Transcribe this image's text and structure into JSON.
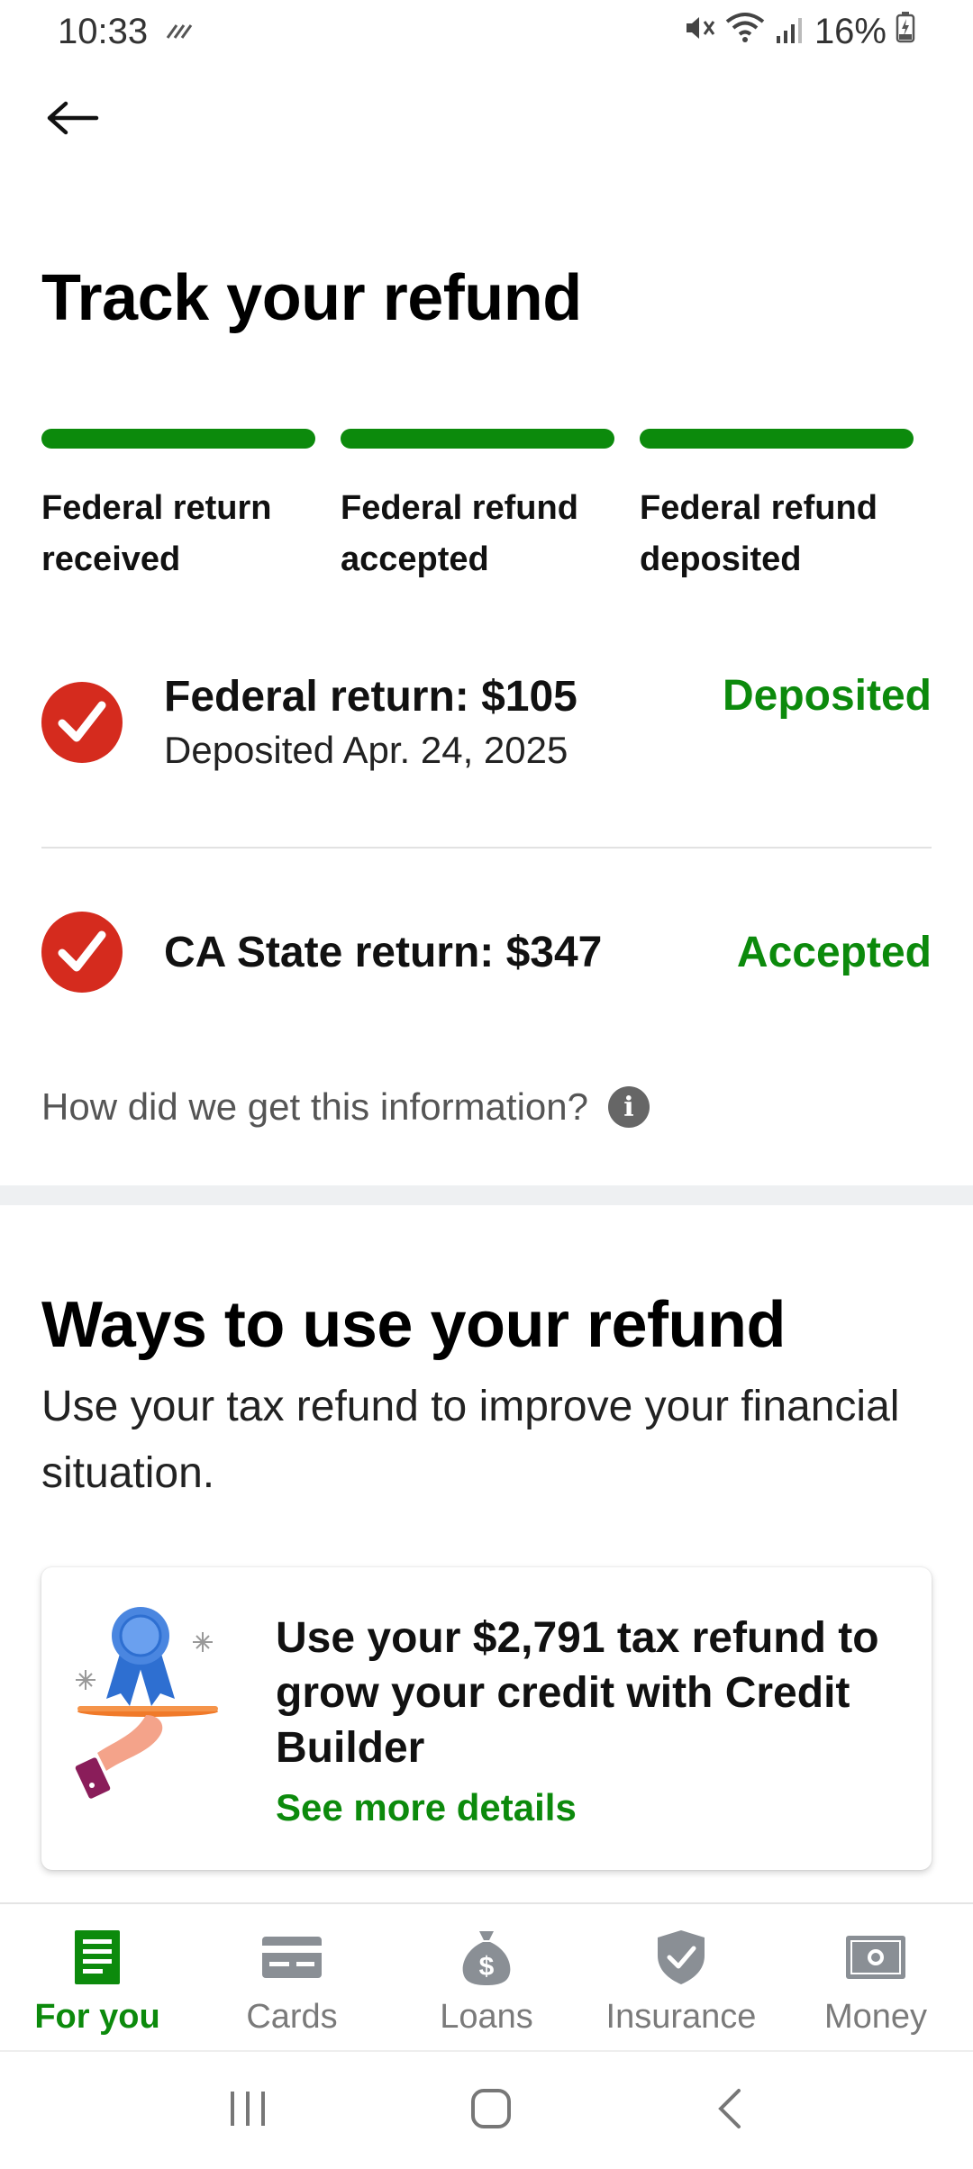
{
  "status_bar": {
    "time": "10:33",
    "battery": "16%"
  },
  "header": {
    "back_icon": "arrow-left-icon",
    "title": "Track your refund"
  },
  "progress": {
    "steps": [
      {
        "label": "Federal return received",
        "line1": "Federal return",
        "line2": "received",
        "complete": true
      },
      {
        "label": "Federal refund accepted",
        "line1": "Federal refund",
        "line2": "accepted",
        "complete": true
      },
      {
        "label": "Federal refund deposited",
        "line1": "Federal refund",
        "line2": "deposited",
        "complete": true
      }
    ],
    "bar_color": "#0c8a0c"
  },
  "refunds": [
    {
      "title": "Federal return: $105",
      "subtitle": "Deposited Apr. 24, 2025",
      "status": "Deposited",
      "icon": "check-circle-icon"
    },
    {
      "title": "CA State return: $347",
      "subtitle": "",
      "status": "Accepted",
      "icon": "check-circle-icon"
    }
  ],
  "info": {
    "text": "How did we get this information?",
    "icon": "info-icon"
  },
  "ways": {
    "title": "Ways to use your refund",
    "subtitle": "Use your tax refund to improve your financial situation."
  },
  "promo": {
    "title": "Use your $2,791 tax refund to grow your credit with Credit Builder",
    "link": "See more details",
    "illustration": "award-ribbon-on-tray-illustration"
  },
  "bottom_nav": {
    "items": [
      {
        "label": "For you",
        "icon": "document-icon",
        "active": true
      },
      {
        "label": "Cards",
        "icon": "card-icon",
        "active": false
      },
      {
        "label": "Loans",
        "icon": "money-bag-icon",
        "active": false
      },
      {
        "label": "Insurance",
        "icon": "shield-check-icon",
        "active": false
      },
      {
        "label": "Money",
        "icon": "banknote-icon",
        "active": false
      }
    ]
  },
  "colors": {
    "accent_green": "#0c8a0c",
    "check_red": "#d52b1e",
    "separator": "#eef0f2"
  }
}
